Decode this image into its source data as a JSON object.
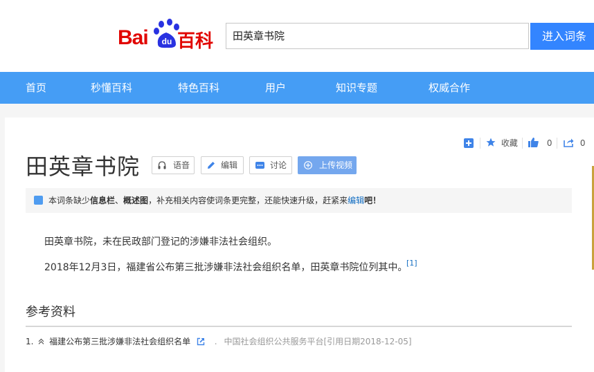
{
  "header": {
    "logo_text_a": "Bai",
    "logo_text_b": "du",
    "logo_text_c": "百科",
    "search_value": "田英章书院",
    "search_button": "进入词条"
  },
  "nav": {
    "items": [
      "首页",
      "秒懂百科",
      "特色百科",
      "用户",
      "知识专题",
      "权威合作"
    ]
  },
  "entry": {
    "title": "田英章书院",
    "tools": {
      "voice": "语音",
      "edit": "编辑",
      "discuss": "讨论",
      "upload_video": "上传视频"
    },
    "actions": {
      "favorite": "收藏",
      "like_count": "0",
      "share_count": "0"
    },
    "notice": {
      "prefix": "本词条缺少",
      "item1": "信息栏",
      "sep": "、",
      "item2": "概述图",
      "middle": "，补充相关内容使词条更完整，还能快速升级，赶紧来",
      "link": "编辑",
      "suffix": "吧！"
    },
    "paragraphs": [
      "田英章书院，未在民政部门登记的涉嫌非法社会组织。",
      "2018年12月3日，福建省公布第三批涉嫌非法社会组织名单，田英章书院位列其中。"
    ],
    "citation_mark": "[1]"
  },
  "references": {
    "heading": "参考资料",
    "items": [
      {
        "index": "1.",
        "title": "福建公布第三批涉嫌非法社会组织名单",
        "dot": ".",
        "source": "中国社会组织公共服务平台[引用日期2018-12-05]"
      }
    ]
  },
  "colors": {
    "brand_red": "#e10601",
    "brand_blue": "#2932e1",
    "nav_blue": "#459df5",
    "search_button_blue": "#3385ff",
    "link_blue": "#136ec2"
  }
}
